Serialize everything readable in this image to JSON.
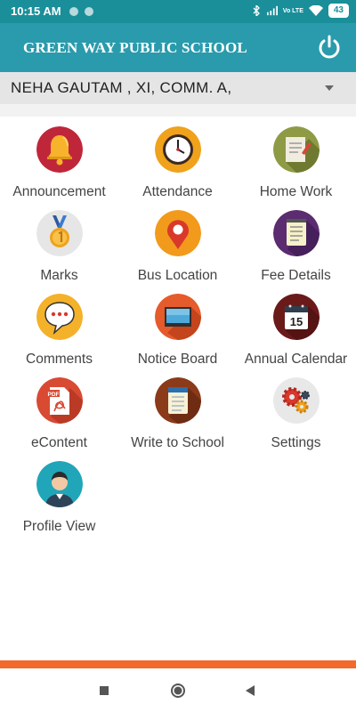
{
  "status_bar": {
    "time": "10:15 AM",
    "network_label": "Vo LTE",
    "battery": "43",
    "icons": [
      "notification-dot-icon",
      "bluetooth-icon",
      "signal-icon",
      "wifi-icon",
      "battery-icon"
    ]
  },
  "app_bar": {
    "title": "GREEN WAY PUBLIC SCHOOL",
    "power_icon": "power-icon"
  },
  "student_selector": {
    "value": "NEHA  GAUTAM , XI, COMM. A,"
  },
  "menu": {
    "items": [
      {
        "label": "Announcement",
        "icon": "bell-icon",
        "color": "#c0263a"
      },
      {
        "label": "Attendance",
        "icon": "clock-icon",
        "color": "#f0a21b"
      },
      {
        "label": "Home Work",
        "icon": "homework-icon",
        "color": "#8f9a45"
      },
      {
        "label": "Marks",
        "icon": "medal-icon",
        "color": "#e6e6e6"
      },
      {
        "label": "Bus Location",
        "icon": "location-pin-icon",
        "color": "#f29a1b"
      },
      {
        "label": "Fee Details",
        "icon": "notepad-icon",
        "color": "#5b2c6f"
      },
      {
        "label": "Comments",
        "icon": "chat-bubble-icon",
        "color": "#f4b12a"
      },
      {
        "label": "Notice Board",
        "icon": "board-icon",
        "color": "#e55b2b"
      },
      {
        "label": "Annual Calendar",
        "icon": "calendar-icon",
        "color": "#6b1a1a"
      },
      {
        "label": "eContent",
        "icon": "pdf-icon",
        "color": "#d94a33"
      },
      {
        "label": "Write to School",
        "icon": "notebook-icon",
        "color": "#8b3a1a"
      },
      {
        "label": "Settings",
        "icon": "gears-icon",
        "color": "#e8e8e8"
      },
      {
        "label": "Profile View",
        "icon": "user-avatar-icon",
        "color": "#20a6b8"
      }
    ],
    "calendar_day": "15",
    "pdf_tag": "PDF"
  },
  "nav_bar": {
    "icons": [
      "recent-apps-icon",
      "home-icon",
      "back-icon"
    ]
  },
  "colors": {
    "status_bar": "#1a8f9a",
    "app_bar": "#2a9bac",
    "accent_bar": "#f2692b"
  }
}
